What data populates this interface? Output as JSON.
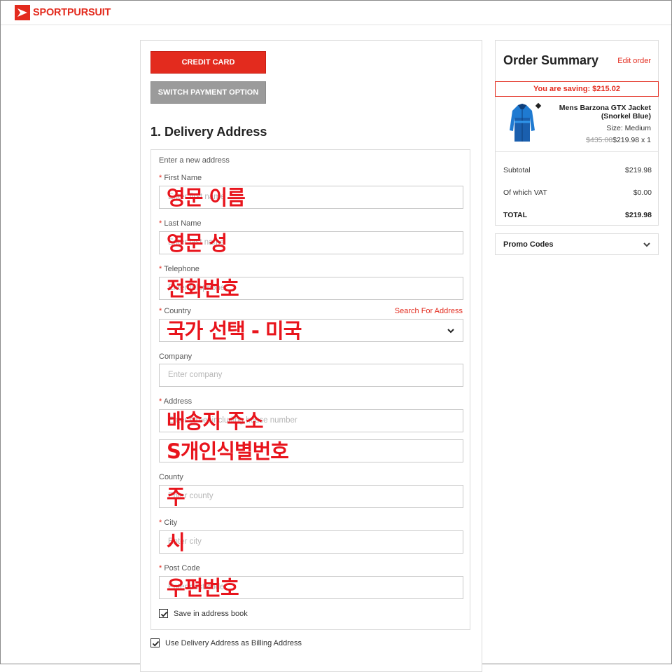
{
  "brand": {
    "name_part1": "SPORT",
    "name_part2": "PURSUIT"
  },
  "payment": {
    "credit_card_label": "CREDIT CARD",
    "switch_label": "SWITCH PAYMENT OPTION"
  },
  "delivery": {
    "title": "1. Delivery Address",
    "hint": "Enter a new address",
    "first_name": {
      "label": "First Name",
      "placeholder": "Enter first name",
      "overlay": "영문 이름"
    },
    "last_name": {
      "label": "Last Name",
      "placeholder": "Enter last name",
      "overlay": "영문 성"
    },
    "telephone": {
      "label": "Telephone",
      "placeholder": "Enter telephone",
      "overlay": "전화번호"
    },
    "country": {
      "label": "Country",
      "search_link": "Search For Address",
      "overlay": "국가 선택 - 미국"
    },
    "company": {
      "label": "Company",
      "placeholder": "Enter company"
    },
    "address": {
      "label": "Address",
      "placeholder": "Enter street including house number",
      "overlay": "배송지 주소",
      "line2_overlay": "S개인식별번호"
    },
    "county": {
      "label": "County",
      "placeholder": "Enter county",
      "overlay": "주"
    },
    "city": {
      "label": "City",
      "placeholder": "Enter city",
      "overlay": "시"
    },
    "post_code": {
      "label": "Post Code",
      "placeholder": "Enter post code",
      "overlay": "우편번호"
    },
    "save_address": {
      "label": "Save in address book",
      "checked": true
    },
    "use_as_billing": {
      "label": "Use Delivery Address as Billing Address",
      "checked": true
    }
  },
  "summary": {
    "title": "Order Summary",
    "edit_label": "Edit order",
    "saving": "You are saving: $215.02",
    "product": {
      "name": "Mens Barzona GTX Jacket (Snorkel Blue)",
      "size": "Size: Medium",
      "old_price": "$435.00",
      "price_qty": "$219.98 x 1"
    },
    "rows": {
      "subtotal_label": "Subtotal",
      "subtotal_value": "$219.98",
      "vat_label": "Of which VAT",
      "vat_value": "$0.00",
      "total_label": "TOTAL",
      "total_value": "$219.98"
    },
    "promo_label": "Promo Codes"
  },
  "colors": {
    "accent": "#e32b1e",
    "overlay_text": "#e8141c",
    "button_grey": "#9b9b9b"
  }
}
